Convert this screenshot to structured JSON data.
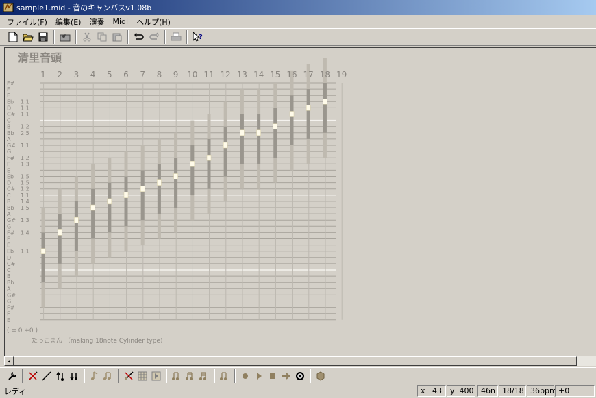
{
  "window": {
    "title": "sample1.mid - 音のキャンバスv1.08b"
  },
  "menu": [
    {
      "label": "ファイル(F)"
    },
    {
      "label": "編集(E)"
    },
    {
      "label": "演奏"
    },
    {
      "label": "Midi"
    },
    {
      "label": "ヘルプ(H)"
    }
  ],
  "toolbar": [
    {
      "icon": "new-file-icon"
    },
    {
      "icon": "open-folder-icon"
    },
    {
      "icon": "save-disk-icon"
    },
    {
      "icon": "open-music-folder-icon"
    },
    {
      "icon": "cut-scissors-icon"
    },
    {
      "icon": "copy-icon"
    },
    {
      "icon": "paste-icon"
    },
    {
      "icon": "undo-icon"
    },
    {
      "icon": "redo-icon"
    },
    {
      "icon": "print-icon"
    },
    {
      "icon": "context-help-icon"
    }
  ],
  "score": {
    "title": "清里音頭",
    "columns": [
      "1",
      "2",
      "3",
      "4",
      "5",
      "6",
      "7",
      "8",
      "9",
      "10",
      "11",
      "12",
      "13",
      "14",
      "15",
      "16",
      "17",
      "18",
      "19"
    ],
    "rows": [
      {
        "note": "F#",
        "count": ""
      },
      {
        "note": "F",
        "count": ""
      },
      {
        "note": "E",
        "count": ""
      },
      {
        "note": "Eb",
        "count": "1 1"
      },
      {
        "note": "D",
        "count": "1 1"
      },
      {
        "note": "C#",
        "count": "1 1"
      },
      {
        "note": "C",
        "count": ""
      },
      {
        "note": "B",
        "count": "1 2"
      },
      {
        "note": "Bb",
        "count": "2 5"
      },
      {
        "note": "A",
        "count": ""
      },
      {
        "note": "G#",
        "count": "1 1"
      },
      {
        "note": "G",
        "count": ""
      },
      {
        "note": "F#",
        "count": "1 2"
      },
      {
        "note": "F",
        "count": "1 3"
      },
      {
        "note": "E",
        "count": ""
      },
      {
        "note": "Eb",
        "count": "1 5"
      },
      {
        "note": "D",
        "count": "1 5"
      },
      {
        "note": "C#",
        "count": "1 2"
      },
      {
        "note": "C",
        "count": "1 1"
      },
      {
        "note": "B",
        "count": "1 4"
      },
      {
        "note": "Bb",
        "count": "1 5"
      },
      {
        "note": "A",
        "count": ""
      },
      {
        "note": "G#",
        "count": "1 3"
      },
      {
        "note": "G",
        "count": ""
      },
      {
        "note": "F#",
        "count": "1 4"
      },
      {
        "note": "F",
        "count": ""
      },
      {
        "note": "E",
        "count": ""
      },
      {
        "note": "Eb",
        "count": "1 1"
      },
      {
        "note": "D",
        "count": ""
      },
      {
        "note": "C#",
        "count": ""
      },
      {
        "note": "C",
        "count": ""
      },
      {
        "note": "B",
        "count": ""
      },
      {
        "note": "Bb",
        "count": ""
      },
      {
        "note": "A",
        "count": ""
      },
      {
        "note": "G#",
        "count": ""
      },
      {
        "note": "G",
        "count": ""
      },
      {
        "note": "F#",
        "count": ""
      },
      {
        "note": "F",
        "count": ""
      },
      {
        "note": "E",
        "count": ""
      }
    ],
    "notes": [
      {
        "col": 1,
        "row": 27
      },
      {
        "col": 2,
        "row": 24
      },
      {
        "col": 3,
        "row": 22
      },
      {
        "col": 4,
        "row": 20
      },
      {
        "col": 5,
        "row": 19
      },
      {
        "col": 6,
        "row": 18
      },
      {
        "col": 7,
        "row": 17
      },
      {
        "col": 8,
        "row": 16
      },
      {
        "col": 9,
        "row": 15
      },
      {
        "col": 10,
        "row": 13
      },
      {
        "col": 11,
        "row": 12
      },
      {
        "col": 12,
        "row": 10
      },
      {
        "col": 13,
        "row": 8
      },
      {
        "col": 14,
        "row": 8
      },
      {
        "col": 15,
        "row": 7
      },
      {
        "col": 16,
        "row": 5
      },
      {
        "col": 17,
        "row": 4
      },
      {
        "col": 18,
        "row": 3
      }
    ],
    "footer_left": "( = 0 +0 )",
    "footer_credit": "たっこまん （making 18note Cylinder type)"
  },
  "bottom_toolbar": [
    {
      "icon": "wrench-icon"
    },
    {
      "icon": "delete-line-icon"
    },
    {
      "icon": "pencil-line-icon"
    },
    {
      "icon": "note-up-icon"
    },
    {
      "icon": "note-down-icon"
    },
    {
      "icon": "eighth-note-icon"
    },
    {
      "icon": "beamed-notes-icon"
    },
    {
      "icon": "erase-icon"
    },
    {
      "icon": "grid-icon"
    },
    {
      "icon": "insert-bar-icon"
    },
    {
      "icon": "chord-1-icon"
    },
    {
      "icon": "chord-2-icon"
    },
    {
      "icon": "chord-3-icon"
    },
    {
      "icon": "chord-4-icon"
    },
    {
      "icon": "record-icon"
    },
    {
      "icon": "play-icon"
    },
    {
      "icon": "stop-icon"
    },
    {
      "icon": "step-icon"
    },
    {
      "icon": "loop-icon"
    },
    {
      "icon": "cylinder-icon"
    }
  ],
  "status": {
    "message": "レディ",
    "x_label": "x",
    "x_value": "43",
    "y_label": "y",
    "y_value": "400",
    "note_len": "46n",
    "position": "18/18",
    "tempo": "36bpm",
    "transpose": "+0"
  }
}
